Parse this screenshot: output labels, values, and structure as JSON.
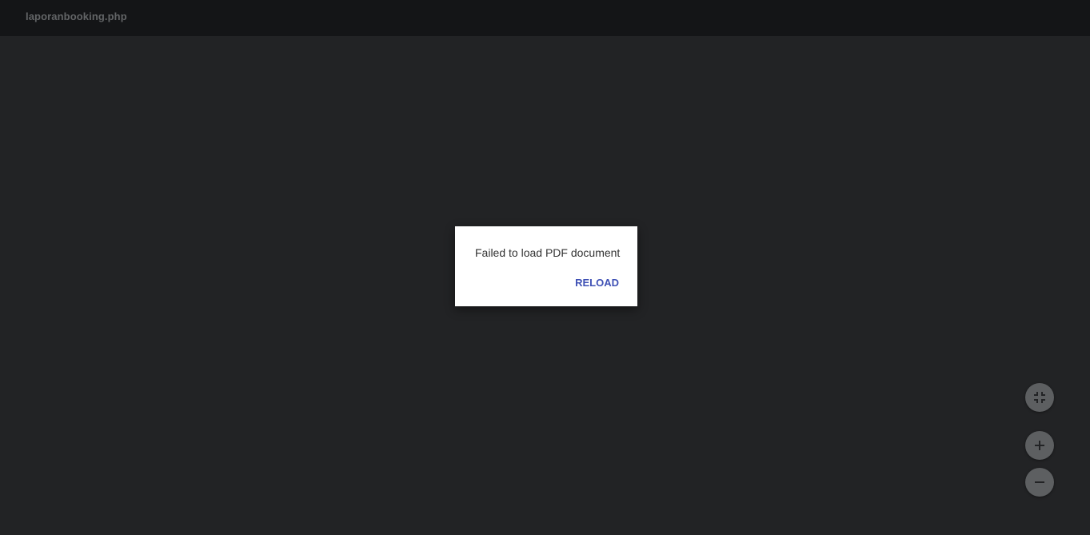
{
  "toolbar": {
    "title": "laporanbooking.php"
  },
  "error_dialog": {
    "message": "Failed to load PDF document",
    "reload_label": "RELOAD"
  },
  "zoom_controls": {
    "buttons": [
      {
        "icon": "fit-to-page-icon"
      },
      {
        "icon": "zoom-in-icon"
      },
      {
        "icon": "zoom-out-icon"
      }
    ]
  },
  "colors": {
    "toolbar_bg": "#141517",
    "viewer_bg": "#222325",
    "accent": "#3f51b5",
    "fab_bg": "#5d5f61"
  }
}
